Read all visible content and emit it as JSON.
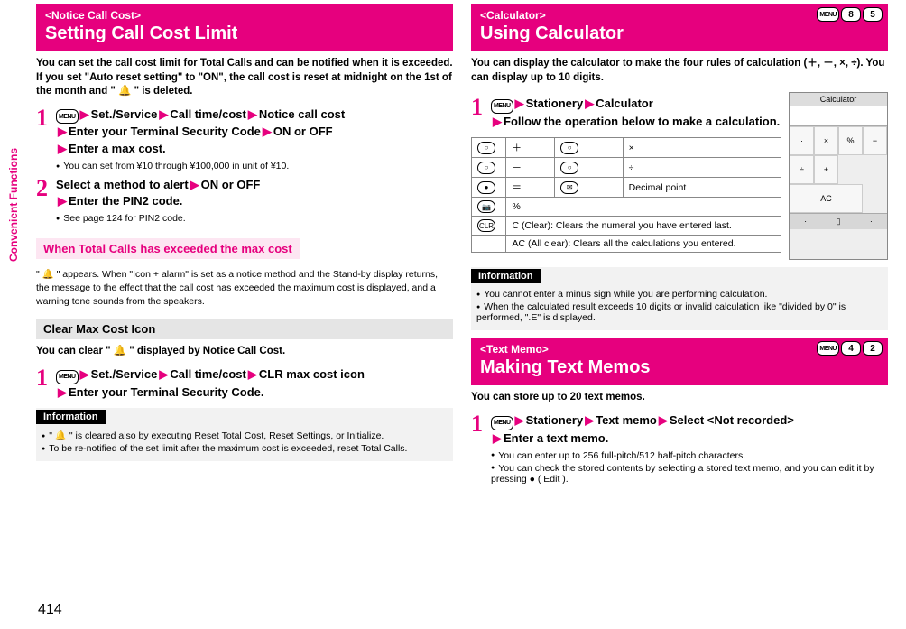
{
  "sideTab": "Convenient Functions",
  "pageNumber": "414",
  "left": {
    "section": {
      "tag": "<Notice Call Cost>",
      "title": "Setting Call Cost Limit"
    },
    "intro": "You can set the call cost limit for Total Calls and can be notified when it is exceeded. If you set \"Auto reset setting\" to \"ON\", the call cost is reset at midnight on the 1st of the month and \" 🔔 \" is deleted.",
    "step1": {
      "crumbs": [
        "Set./Service",
        "Call time/cost",
        "Notice call cost",
        "Enter your Terminal Security Code",
        "ON or OFF",
        "Enter a max cost."
      ],
      "notes": [
        "You can set from ¥10 through ¥100,000 in unit of ¥10."
      ]
    },
    "step2": {
      "line1a": "Select a method to alert",
      "line1b": "ON or OFF",
      "line2": "Enter the PIN2 code.",
      "notes": [
        "See page 124 for PIN2 code."
      ]
    },
    "subPink": "When Total Calls has exceeded the max cost",
    "pinkBody": "\" 🔔 \" appears. When \"Icon + alarm\" is set as a notice method and the Stand-by display returns, the message to the effect that the call cost has exceeded the maximum cost is displayed, and a warning tone sounds from the speakers.",
    "subGray": "Clear Max Cost Icon",
    "grayIntro": "You can clear \" 🔔 \" displayed by Notice Call Cost.",
    "step1b": {
      "crumbs": [
        "Set./Service",
        "Call time/cost",
        "CLR max cost icon",
        "Enter your Terminal Security Code."
      ]
    },
    "info": {
      "label": "Information",
      "items": [
        "\" 🔔 \" is cleared also by executing Reset Total Cost, Reset Settings, or Initialize.",
        "To be re-notified of the set limit after the maximum cost is exceeded, reset Total Calls."
      ]
    }
  },
  "right": {
    "calc": {
      "tag": "<Calculator>",
      "title": "Using Calculator",
      "shortcut": [
        "MENU",
        "8",
        "5"
      ],
      "intro": "You can display the calculator to make the four rules of calculation (＋, －, ×, ÷). You can display up to 10 digits.",
      "step": {
        "crumbs": [
          "Stationery",
          "Calculator",
          "Follow the operation below to make a calculation."
        ]
      },
      "table": [
        {
          "k": "○",
          "v": "＋",
          "k2": "○",
          "v2": "×"
        },
        {
          "k": "○",
          "v": "－",
          "k2": "○",
          "v2": "÷"
        },
        {
          "k": "●",
          "v": "＝",
          "k2": "✉",
          "v2": "Decimal point"
        },
        {
          "k": "📷",
          "v": "%",
          "colspan": true
        },
        {
          "k": "CLR",
          "v": "C (Clear): Clears the numeral you have entered last.",
          "full": true
        },
        {
          "k": "",
          "v": "AC (All clear): Clears all the calculations you entered.",
          "full": true
        }
      ],
      "screenshot": {
        "title": "Calculator",
        "grid": [
          "·",
          "×",
          "%",
          "−",
          "÷",
          "+",
          "AC",
          "",
          "",
          ""
        ]
      },
      "info": {
        "label": "Information",
        "items": [
          "You cannot enter a minus sign while you are performing calculation.",
          "When the calculated result exceeds 10 digits or invalid calculation like \"divided by 0\" is performed, \".E\" is displayed."
        ]
      }
    },
    "memo": {
      "tag": "<Text Memo>",
      "title": "Making Text Memos",
      "shortcut": [
        "MENU",
        "4",
        "2"
      ],
      "intro": "You can store up to 20 text memos.",
      "step": {
        "crumbs": [
          "Stationery",
          "Text memo",
          "Select <Not recorded>",
          "Enter a text memo."
        ]
      },
      "notes": [
        "You can enter up to 256 full-pitch/512 half-pitch characters.",
        "You can check the stored contents by selecting a stored text memo, and you can edit it by pressing ● ( Edit )."
      ]
    }
  }
}
